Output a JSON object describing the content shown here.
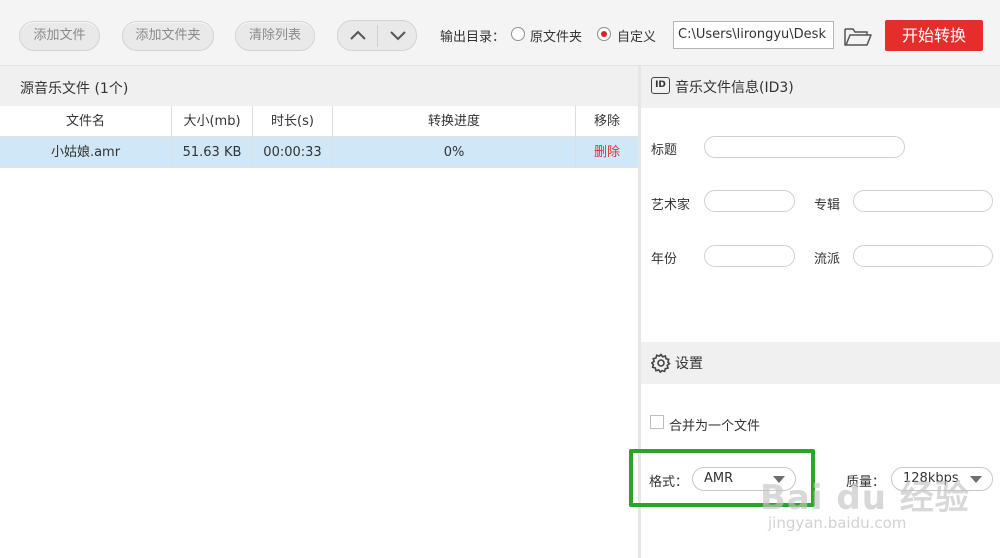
{
  "toolbar": {
    "add_file": "添加文件",
    "add_folder": "添加文件夹",
    "clear_list": "清除列表",
    "output_dir_label": "输出目录：",
    "radio_original": "原文件夹",
    "radio_custom": "自定义",
    "selected_output": "自定义",
    "output_path": "C:\\Users\\lirongyu\\Desk",
    "start_convert": "开始转换",
    "icons": [
      "chevron-up-icon",
      "chevron-down-icon",
      "folder-open-icon"
    ]
  },
  "source": {
    "title": "源音乐文件 (1个)",
    "columns": [
      "文件名",
      "大小(mb)",
      "时长(s)",
      "转换进度",
      "移除"
    ],
    "rows": [
      {
        "name": "小姑娘.amr",
        "size": "51.63 KB",
        "duration": "00:00:33",
        "progress": "0%",
        "remove": "删除"
      }
    ]
  },
  "id3": {
    "title": "音乐文件信息(ID3)",
    "icon_text": "ID",
    "label_title": "标题",
    "label_artist": "艺术家",
    "label_album": "专辑",
    "label_year": "年份",
    "label_genre": "流派"
  },
  "settings": {
    "title": "设置",
    "merge_label": "合并为一个文件",
    "merge_checked": false,
    "format_label": "格式：",
    "format_value": "AMR",
    "quality_label": "质量：",
    "quality_value": "128kbps"
  },
  "watermark": {
    "brand": "Bai du 经验",
    "url": "jingyan.baidu.com"
  },
  "colors": {
    "accent_red": "#e52e2b",
    "selected_row": "#cfe7f6",
    "highlight_green": "#2aa52a"
  }
}
